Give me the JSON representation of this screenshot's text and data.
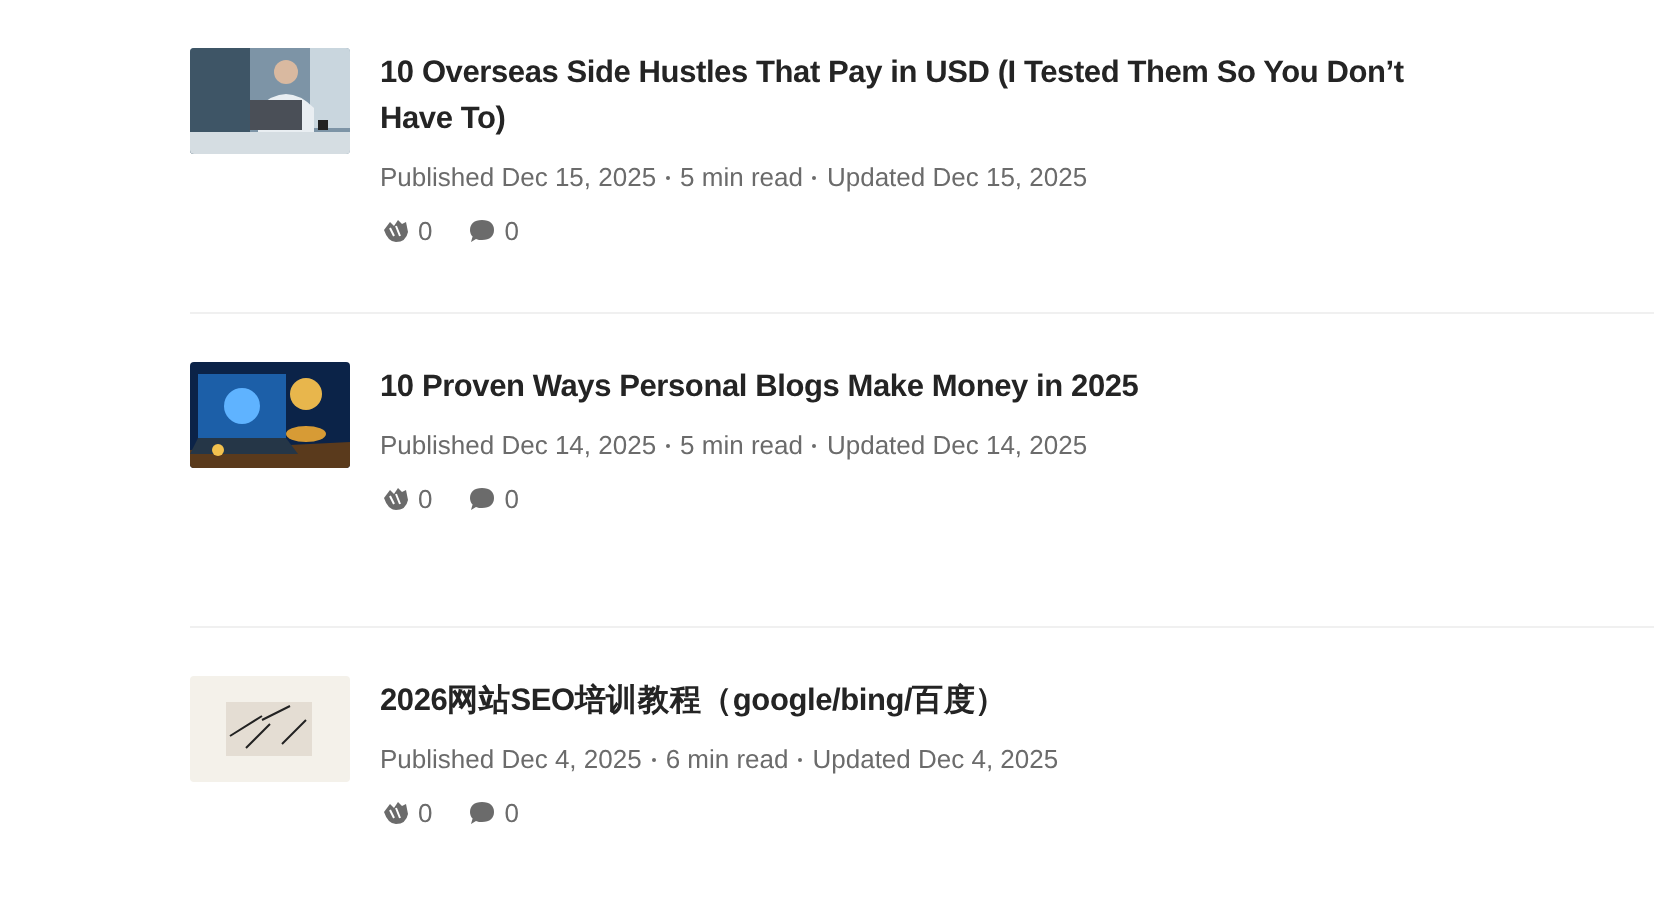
{
  "articles": [
    {
      "title": "10 Overseas Side Hustles That Pay in USD (I Tested Them So You Don’t Have To)",
      "published": "Published Dec 15, 2025",
      "read_time": "5 min read",
      "updated": "Updated Dec 15, 2025",
      "claps": "0",
      "comments": "0"
    },
    {
      "title": "10 Proven Ways Personal Blogs Make Money in 2025",
      "published": "Published Dec 14, 2025",
      "read_time": "5 min read",
      "updated": "Updated Dec 14, 2025",
      "claps": "0",
      "comments": "0"
    },
    {
      "title": "2026网站SEO培训教程（google/bing/百度）",
      "published": "Published Dec 4, 2025",
      "read_time": "6 min read",
      "updated": "Updated Dec 4, 2025",
      "claps": "0",
      "comments": "0"
    }
  ]
}
